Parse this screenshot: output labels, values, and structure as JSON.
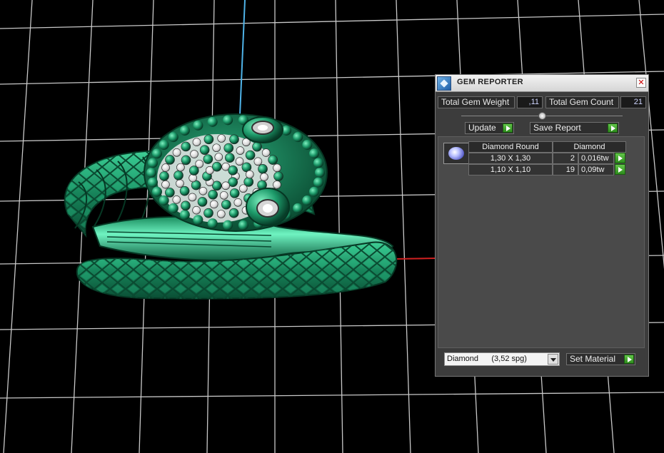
{
  "panel": {
    "title": "GEM REPORTER",
    "close_glyph": "✕",
    "total_gem_weight_label": "Total Gem Weight",
    "total_gem_weight_value": ",11",
    "total_gem_count_label": "Total Gem Count",
    "total_gem_count_value": "21",
    "update_label": "Update",
    "save_report_label": "Save Report",
    "set_material_label": "Set Material"
  },
  "gem_table": {
    "headers": [
      "Diamond Round",
      "Diamond"
    ],
    "rows": [
      {
        "size": "1,30 X 1,30",
        "count": "2",
        "weight": "0,016tw"
      },
      {
        "size": "1,10 X 1,10",
        "count": "19",
        "weight": "0,09tw"
      }
    ]
  },
  "material_select": {
    "value": "Diamond      (3,52 spg)"
  },
  "icons": {
    "app": "gem-reporter-icon",
    "gem_thumbnail": "diamond-icon",
    "row_action": "play-icon"
  },
  "colors": {
    "viewport_bg": "#000000",
    "grid": "#c8c8c8",
    "model": "#1e9a6e",
    "accent_green": "#3aa62b",
    "axis_y": "#4fb3e8",
    "axis_x": "#d02020"
  }
}
